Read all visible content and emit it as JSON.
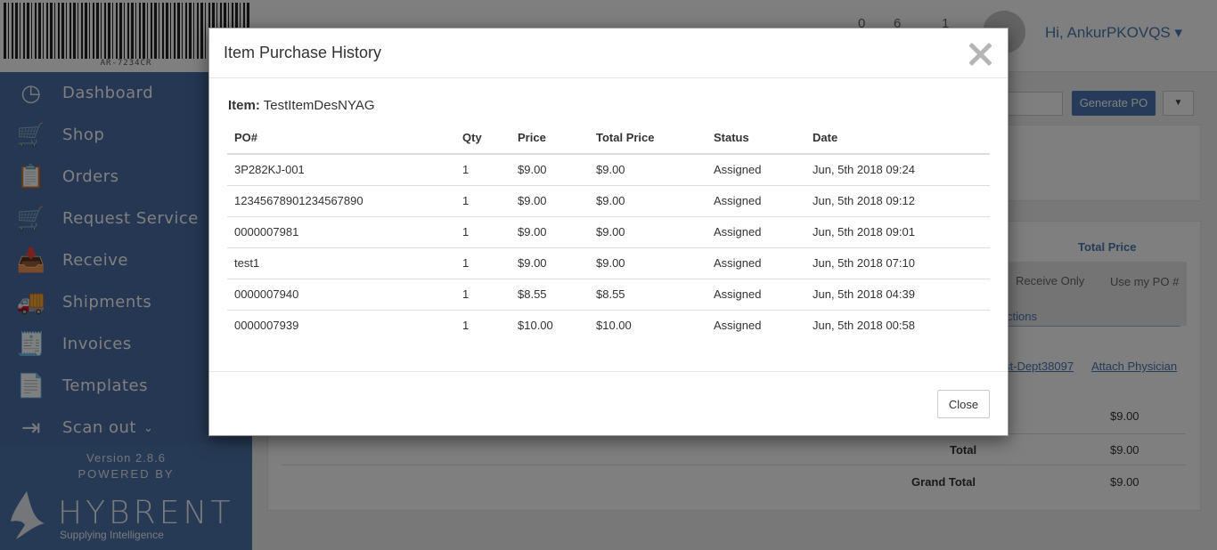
{
  "sidebar": {
    "barcode_text": "AR-7234CR",
    "items": [
      {
        "label": "Dashboard",
        "icon": "dashboard-icon",
        "glyph": "◷"
      },
      {
        "label": "Shop",
        "icon": "cart-icon",
        "glyph": "🛒"
      },
      {
        "label": "Orders",
        "icon": "orders-icon",
        "glyph": "📋"
      },
      {
        "label": "Request Service",
        "icon": "service-cart-icon",
        "glyph": "🛒"
      },
      {
        "label": "Receive",
        "icon": "receive-icon",
        "glyph": "📥"
      },
      {
        "label": "Shipments",
        "icon": "truck-icon",
        "glyph": "🚚"
      },
      {
        "label": "Invoices",
        "icon": "invoice-icon",
        "glyph": "🧾"
      },
      {
        "label": "Templates",
        "icon": "templates-icon",
        "glyph": "📄"
      },
      {
        "label": "Scan out",
        "icon": "scan-out-icon",
        "glyph": "⇥"
      }
    ],
    "version": "Version 2.8.6",
    "powered_by": "POWERED BY",
    "brand": "HYBRENT",
    "tagline": "Supplying Intelligence"
  },
  "header": {
    "stats": [
      "0",
      "6",
      "1"
    ],
    "greeting": "Hi, AnkurPKOVQS ▾"
  },
  "background": {
    "generate_po": "Generate PO",
    "total_price_head": "Total Price",
    "receive_only": "Receive Only",
    "use_my_po": "Use my PO #",
    "actions": "ctions",
    "dept_link": "st-Dept38097",
    "attach_physician": "Attach Physician",
    "row_price": "$9.00",
    "total_label": "Total",
    "total_value": "$9.00",
    "grand_total_label": "Grand Total",
    "grand_total_value": "$9.00"
  },
  "modal": {
    "title": "Item Purchase History",
    "item_label": "Item:",
    "item_value": "TestItemDesNYAG",
    "columns": [
      "PO#",
      "Qty",
      "Price",
      "Total Price",
      "Status",
      "Date"
    ],
    "rows": [
      [
        "3P282KJ-001",
        "1",
        "$9.00",
        "$9.00",
        "Assigned",
        "Jun, 5th 2018 09:24"
      ],
      [
        "12345678901234567890",
        "1",
        "$9.00",
        "$9.00",
        "Assigned",
        "Jun, 5th 2018 09:12"
      ],
      [
        "0000007981",
        "1",
        "$9.00",
        "$9.00",
        "Assigned",
        "Jun, 5th 2018 09:01"
      ],
      [
        "test1",
        "1",
        "$9.00",
        "$9.00",
        "Assigned",
        "Jun, 5th 2018 07:10"
      ],
      [
        "0000007940",
        "1",
        "$8.55",
        "$8.55",
        "Assigned",
        "Jun, 5th 2018 04:39"
      ],
      [
        "0000007939",
        "1",
        "$10.00",
        "$10.00",
        "Assigned",
        "Jun, 5th 2018 00:58"
      ]
    ],
    "close_label": "Close"
  },
  "colors": {
    "sidebar": "#4a6fa5",
    "accent": "#4b77b3",
    "overlay": "rgba(0,0,0,0.5)"
  }
}
